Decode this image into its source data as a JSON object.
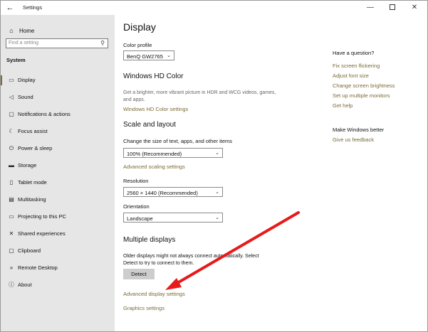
{
  "window": {
    "title": "Settings",
    "back": "←",
    "minimize": "—",
    "close": "✕"
  },
  "sidebar": {
    "home": "Home",
    "search_placeholder": "Find a setting",
    "section": "System",
    "items": [
      {
        "label": "Display",
        "icon": "monitor-icon",
        "glyph": "▭",
        "active": true
      },
      {
        "label": "Sound",
        "icon": "speaker-icon",
        "glyph": "◁"
      },
      {
        "label": "Notifications & actions",
        "icon": "notification-icon",
        "glyph": "▢"
      },
      {
        "label": "Focus assist",
        "icon": "moon-icon",
        "glyph": "☾"
      },
      {
        "label": "Power & sleep",
        "icon": "power-icon",
        "glyph": "⏻"
      },
      {
        "label": "Storage",
        "icon": "storage-icon",
        "glyph": "▬"
      },
      {
        "label": "Tablet mode",
        "icon": "tablet-icon",
        "glyph": "▯"
      },
      {
        "label": "Multitasking",
        "icon": "multitasking-icon",
        "glyph": "▤"
      },
      {
        "label": "Projecting to this PC",
        "icon": "projector-icon",
        "glyph": "▭"
      },
      {
        "label": "Shared experiences",
        "icon": "share-icon",
        "glyph": "✕"
      },
      {
        "label": "Clipboard",
        "icon": "clipboard-icon",
        "glyph": "▢"
      },
      {
        "label": "Remote Desktop",
        "icon": "remote-desktop-icon",
        "glyph": "»"
      },
      {
        "label": "About",
        "icon": "info-icon",
        "glyph": "ⓘ"
      }
    ]
  },
  "main": {
    "title": "Display",
    "color_profile": {
      "label": "Color profile",
      "value": "BenQ GW2765"
    },
    "hd_color": {
      "heading": "Windows HD Color",
      "desc": "Get a brighter, more vibrant picture in HDR and WCG videos, games, and apps.",
      "link": "Windows HD Color settings"
    },
    "scale": {
      "heading": "Scale and layout",
      "size_label": "Change the size of text, apps, and other items",
      "size_value": "100% (Recommended)",
      "advanced_link": "Advanced scaling settings",
      "resolution_label": "Resolution",
      "resolution_value": "2560 × 1440 (Recommended)",
      "orientation_label": "Orientation",
      "orientation_value": "Landscape"
    },
    "multi": {
      "heading": "Multiple displays",
      "desc": "Older displays might not always connect automatically. Select Detect to try to connect to them.",
      "detect": "Detect",
      "advanced_link": "Advanced display settings",
      "graphics_link": "Graphics settings"
    }
  },
  "aside": {
    "question": "Have a question?",
    "links": [
      "Fix screen flickering",
      "Adjust font size",
      "Change screen brightness",
      "Set up multiple monitors",
      "Get help"
    ],
    "better": "Make Windows better",
    "feedback": "Give us feedback"
  },
  "colors": {
    "accent_link": "#7a6a35",
    "arrow": "#e8191b",
    "sidebar_bg": "#e6e6e6"
  }
}
